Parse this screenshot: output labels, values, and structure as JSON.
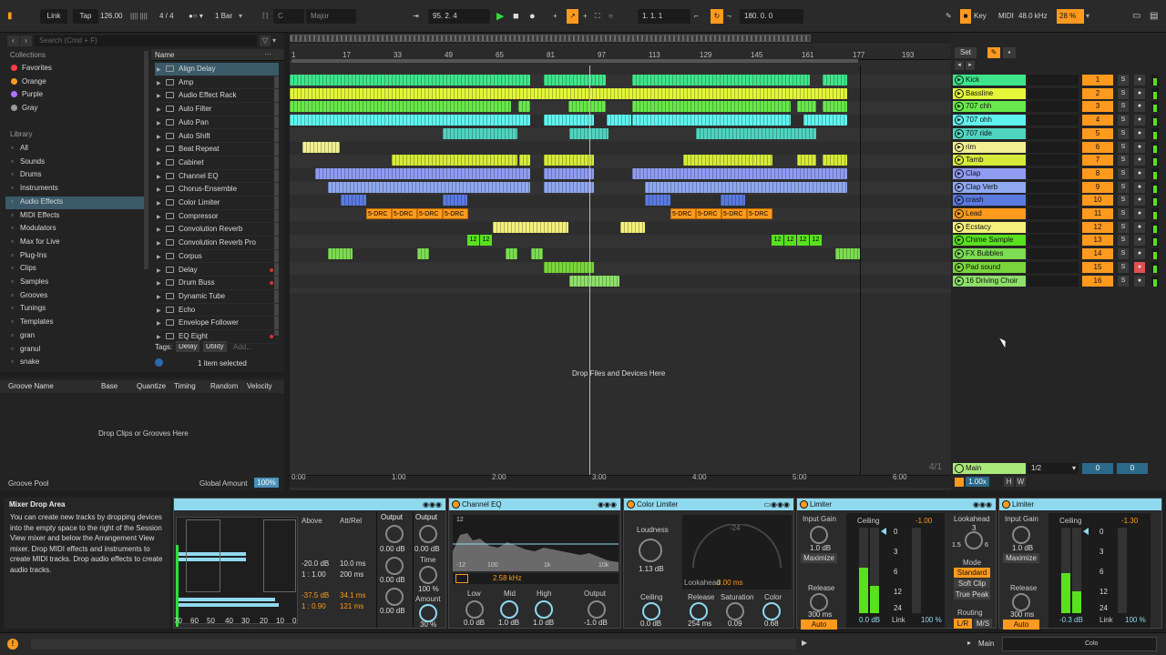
{
  "transport": {
    "link": "Link",
    "tap": "Tap",
    "tempo": "126.00",
    "time_sig": "4 / 4",
    "quantize": "1 Bar",
    "key": "C",
    "scale": "Major",
    "position": "95.  2.  4",
    "loop_start": "1.  1.  1",
    "loop_length": "180.  0.  0",
    "key_label": "Key",
    "midi_label": "MIDI",
    "sample_rate": "48.0 kHz",
    "cpu": "28 %"
  },
  "browser": {
    "search_placeholder": "Search (Cmd + F)",
    "collections_header": "Collections",
    "collections": [
      {
        "label": "Favorites",
        "color": "#ff4040"
      },
      {
        "label": "Orange",
        "color": "#ff9a1e"
      },
      {
        "label": "Purple",
        "color": "#b070ff"
      },
      {
        "label": "Gray",
        "color": "#9a9a9a"
      }
    ],
    "library_header": "Library",
    "library": [
      {
        "label": "All",
        "icon": "grid-icon"
      },
      {
        "label": "Sounds",
        "icon": "sound-icon"
      },
      {
        "label": "Drums",
        "icon": "drum-icon"
      },
      {
        "label": "Instruments",
        "icon": "instrument-icon"
      },
      {
        "label": "Audio Effects",
        "icon": "audio-effects-icon"
      },
      {
        "label": "MIDI Effects",
        "icon": "midi-effects-icon"
      },
      {
        "label": "Modulators",
        "icon": "modulator-icon"
      },
      {
        "label": "Max for Live",
        "icon": "max-icon"
      },
      {
        "label": "Plug-Ins",
        "icon": "plugin-icon"
      },
      {
        "label": "Clips",
        "icon": "clip-icon"
      },
      {
        "label": "Samples",
        "icon": "sample-icon"
      },
      {
        "label": "Grooves",
        "icon": "groove-icon"
      },
      {
        "label": "Tunings",
        "icon": "tuning-icon"
      },
      {
        "label": "Templates",
        "icon": "template-icon"
      },
      {
        "label": "gran",
        "icon": "folder-icon"
      },
      {
        "label": "granul",
        "icon": "folder-icon"
      },
      {
        "label": "snake",
        "icon": "folder-icon"
      }
    ],
    "name_header": "Name",
    "items": [
      "Align Delay",
      "Amp",
      "Audio Effect Rack",
      "Auto Filter",
      "Auto Pan",
      "Auto Shift",
      "Beat Repeat",
      "Cabinet",
      "Channel EQ",
      "Chorus-Ensemble",
      "Color Limiter",
      "Compressor",
      "Convolution Reverb",
      "Convolution Reverb Pro",
      "Corpus",
      "Delay",
      "Drum Buss",
      "Dynamic Tube",
      "Echo",
      "Envelope Follower",
      "EQ Eight"
    ],
    "tags_label": "Tags:",
    "tags": [
      "Delay",
      "Utility",
      "Add..."
    ],
    "selection_info": "1 item selected"
  },
  "groove": {
    "columns": [
      "Groove Name",
      "Base",
      "Quantize",
      "Timing",
      "Random",
      "Velocity"
    ],
    "drop_hint": "Drop Clips or Grooves Here",
    "pool_label": "Groove Pool",
    "global_amount_label": "Global Amount",
    "global_amount": "100%"
  },
  "arrangement": {
    "bar_markers": [
      "1",
      "17",
      "33",
      "49",
      "65",
      "81",
      "97",
      "113",
      "129",
      "145",
      "161",
      "177",
      "193"
    ],
    "time_markers": [
      "0:00",
      "1:00",
      "2:00",
      "3:00",
      "4:00",
      "5:00",
      "6:00"
    ],
    "drop_hint": "Drop Files and Devices Here",
    "zoom_label": "4/1",
    "drc_label": "5-DRC",
    "tn_label": "12"
  },
  "mixer": {
    "set_label": "Set",
    "tracks": [
      {
        "name": "Kick",
        "num": "1",
        "color": "#3ee58b"
      },
      {
        "name": "Bassline",
        "num": "2",
        "color": "#e4f53a"
      },
      {
        "name": "707 chh",
        "num": "3",
        "color": "#68e84a"
      },
      {
        "name": "707 ohh",
        "num": "4",
        "color": "#5ff3ee"
      },
      {
        "name": "707 ride",
        "num": "5",
        "color": "#4fd4c0"
      },
      {
        "name": "rim",
        "num": "6",
        "color": "#f1f092"
      },
      {
        "name": "Tamb",
        "num": "7",
        "color": "#d6ea3a"
      },
      {
        "name": "Clap",
        "num": "8",
        "color": "#8f9cf2"
      },
      {
        "name": "Clap Verb",
        "num": "9",
        "color": "#8fa8f0"
      },
      {
        "name": "crash",
        "num": "10",
        "color": "#5a7ae0"
      },
      {
        "name": "Lead",
        "num": "11",
        "color": "#ff9a1e"
      },
      {
        "name": "Ecstacy",
        "num": "12",
        "color": "#f4f07a"
      },
      {
        "name": "Chime Sample",
        "num": "13",
        "color": "#59e01f"
      },
      {
        "name": "FX Bubbles",
        "num": "14",
        "color": "#7cdc52"
      },
      {
        "name": "Pad sound",
        "num": "15",
        "color": "#79d63a"
      },
      {
        "name": "16 Driving Choir",
        "num": "16",
        "color": "#8ee06a"
      }
    ],
    "solo_label": "S",
    "main_label": "Main",
    "main_ratio": "1/2",
    "main_val1": "0",
    "main_val2": "0",
    "main_zoom": "1.00x",
    "h_label": "H",
    "w_label": "W"
  },
  "info": {
    "title": "Mixer Drop Area",
    "body": "You can create new tracks by dropping devices into the empty space to the right of the Session View mixer and below the Arrangement View mixer. Drop MIDI effects and instruments to create MIDI tracks. Drop audio effects to create audio tracks."
  },
  "devices": {
    "align": {
      "above": "Above",
      "attrel": "Att/Rel",
      "r1a": "-20.0 dB",
      "r1b": "10.0 ms",
      "r2a": "1 : 1.00",
      "r2b": "200 ms",
      "r3a": "-37.5 dB",
      "r3b": "34.1 ms",
      "r4a": "1 : 0.90",
      "r4b": "121 ms",
      "scale": [
        "70",
        "60",
        "50",
        "40",
        "30",
        "20",
        "10",
        "0"
      ],
      "out_label": "Output",
      "out1": "0.00 dB",
      "out2": "0.00 dB",
      "out3": "0.00 dB",
      "out2_label": "Output",
      "out2_val": "0.00 dB",
      "time_label": "Time",
      "time_val": "100 %",
      "amount_label": "Amount",
      "amount_val": "30 %"
    },
    "ceq": {
      "title": "Channel EQ",
      "grid_top": "12",
      "grid_bot": "-12",
      "f100": "100",
      "f1k": "1k",
      "f10k": "10k",
      "freq": "2.58 kHz",
      "low_l": "Low",
      "mid_l": "Mid",
      "high_l": "High",
      "out_l": "Output",
      "low_v": "0.0 dB",
      "mid_v": "1.0 dB",
      "high_v": "1.0 dB",
      "out_v": "-1.0 dB"
    },
    "cl": {
      "title": "Color Limiter",
      "loud_l": "Loudness",
      "loud_v": "1.13 dB",
      "gauge": "-24",
      "lookahead_l": "Lookahead",
      "lookahead_v": "0.00 ms",
      "ceil_l": "Ceiling",
      "ceil_v": "0.0 dB",
      "rel_l": "Release",
      "rel_v": "254 ms",
      "sat_l": "Saturation",
      "sat_v": "0.09",
      "col_l": "Color",
      "col_v": "0.68"
    },
    "lim1": {
      "title": "Limiter",
      "ig_l": "Input Gain",
      "ig_v": "1.0 dB",
      "max": "Maximize",
      "rel_l": "Release",
      "rel_v": "300 ms",
      "auto": "Auto",
      "ceil_l": "Ceiling",
      "ceil_v": "-1.00",
      "meter": [
        "0",
        "3",
        "6",
        "12",
        "24"
      ],
      "ceil_db": "0.0 dB",
      "link_l": "Link",
      "link_v": "100 %",
      "la_l": "Lookahead",
      "la_v": "3",
      "la_s1": "1.5",
      "la_s2": "6",
      "mode_l": "Mode",
      "mode_std": "Standard",
      "mode_soft": "Soft Clip",
      "mode_tp": "True Peak",
      "route_l": "Routing",
      "lr": "L/R",
      "ms": "M/S"
    },
    "lim2": {
      "title": "Limiter",
      "ig_l": "Input Gain",
      "ig_v": "1.0 dB",
      "max": "Maximize",
      "rel_l": "Release",
      "rel_v": "300 ms",
      "auto": "Auto",
      "ceil_l": "Ceiling",
      "ceil_v": "-1.30",
      "ceil_db": "-0.3 dB",
      "link_l": "Link",
      "link_v": "100 %"
    }
  },
  "status": {
    "main": "Main",
    "thumb": "Colo"
  },
  "colors": {
    "accent": "#ff9a1e",
    "header_blue": "#8fd9ef"
  }
}
